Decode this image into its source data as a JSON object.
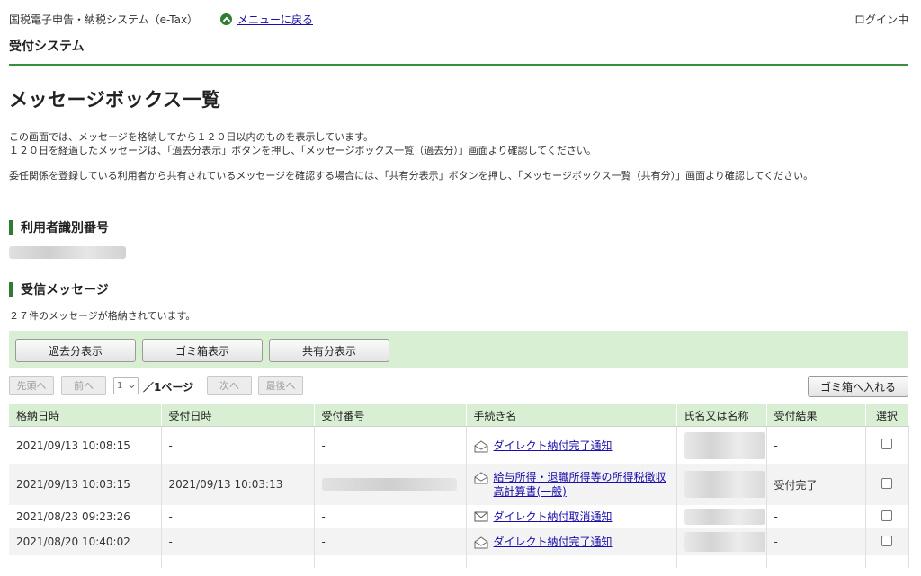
{
  "header": {
    "system_name": "国税電子申告・納税システム（e-Tax）",
    "back_link": "メニューに戻る",
    "login_status": "ログイン中",
    "subsystem": "受付システム"
  },
  "page": {
    "title": "メッセージボックス一覧",
    "desc1_line1": "この画面では、メッセージを格納してから１２０日以内のものを表示しています。",
    "desc1_line2": "１２０日を経過したメッセージは、「過去分表示」ボタンを押し、「メッセージボックス一覧（過去分）」画面より確認してください。",
    "desc2": "委任関係を登録している利用者から共有されているメッセージを確認する場合には、「共有分表示」ボタンを押し、「メッセージボックス一覧（共有分）」画面より確認してください。"
  },
  "section_user": {
    "title": "利用者識別番号"
  },
  "section_inbox": {
    "title": "受信メッセージ",
    "count_text": "２７件のメッセージが格納されています。"
  },
  "buttons": {
    "past": "過去分表示",
    "trash": "ゴミ箱表示",
    "shared": "共有分表示",
    "move_to_trash": "ゴミ箱へ入れる"
  },
  "pager": {
    "first": "先頭へ",
    "prev": "前へ",
    "page_value": "1",
    "total": "／1ページ",
    "next": "次へ",
    "last": "最後へ"
  },
  "table": {
    "headers": [
      "格納日時",
      "受付日時",
      "受付番号",
      "手続き名",
      "氏名又は名称",
      "受付結果",
      "選択"
    ],
    "rows": [
      {
        "stored": "2021/09/13 10:08:15",
        "received": "-",
        "number": "-",
        "icon": "envelope-open-icon",
        "procedure": "ダイレクト納付完了通知",
        "result": "-"
      },
      {
        "stored": "2021/09/13 10:03:15",
        "received": "2021/09/13 10:03:13",
        "number": "",
        "icon": "envelope-open-icon",
        "procedure": "給与所得・退職所得等の所得税徴収高計算書(一般)",
        "result": "受付完了"
      },
      {
        "stored": "2021/08/23 09:23:26",
        "received": "-",
        "number": "-",
        "icon": "envelope-closed-icon",
        "procedure": "ダイレクト納付取消通知",
        "result": "-"
      },
      {
        "stored": "2021/08/20 10:40:02",
        "received": "-",
        "number": "-",
        "icon": "envelope-open-icon",
        "procedure": "ダイレクト納付完了通知",
        "result": "-"
      }
    ]
  },
  "colors": {
    "accent": "#2e7d32",
    "panel": "#d9efd4",
    "link": "#1a0dab"
  }
}
